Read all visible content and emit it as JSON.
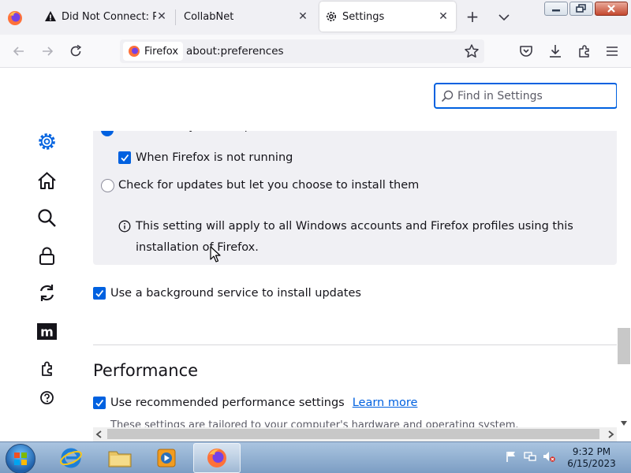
{
  "browser": {
    "tabs": [
      {
        "title": "Did Not Connect: Pote",
        "icon": "warning-icon",
        "active": false
      },
      {
        "title": "CollabNet",
        "icon": "none",
        "active": false
      },
      {
        "title": "Settings",
        "icon": "gear-icon",
        "active": true
      }
    ],
    "tab_close_label": "✕",
    "new_tab_label": "+",
    "url_identity_label": "Firefox",
    "url": "about:preferences"
  },
  "settings": {
    "search_placeholder": "Find in Settings",
    "updates": {
      "auto_install_label": "Automatically install updates (recommended)",
      "when_not_running_label": "When Firefox is not running",
      "when_not_running_checked": true,
      "check_only_label": "Check for updates but let you choose to install them",
      "check_only_selected": false,
      "info_note": "This setting will apply to all Windows accounts and Firefox profiles using this installation of Firefox.",
      "background_service_label": "Use a background service to install updates",
      "background_service_checked": true
    },
    "performance": {
      "title": "Performance",
      "recommended_label": "Use recommended performance settings",
      "recommended_checked": true,
      "learn_more": "Learn more",
      "description": "These settings are tailored to your computer's hardware and operating system."
    },
    "sidebar": [
      "gear-icon",
      "home-icon",
      "search-icon",
      "lock-icon",
      "sync-icon",
      "mozilla-logo-icon",
      "extensions-icon",
      "help-icon"
    ]
  },
  "taskbar": {
    "time": "9:32 PM",
    "date": "6/15/2023",
    "apps": [
      "internet-explorer-icon",
      "file-explorer-icon",
      "media-player-icon",
      "firefox-icon"
    ]
  },
  "colors": {
    "accent": "#0061e0",
    "panel": "#f0f0f4",
    "tabstrip": "#f0f0f4"
  }
}
